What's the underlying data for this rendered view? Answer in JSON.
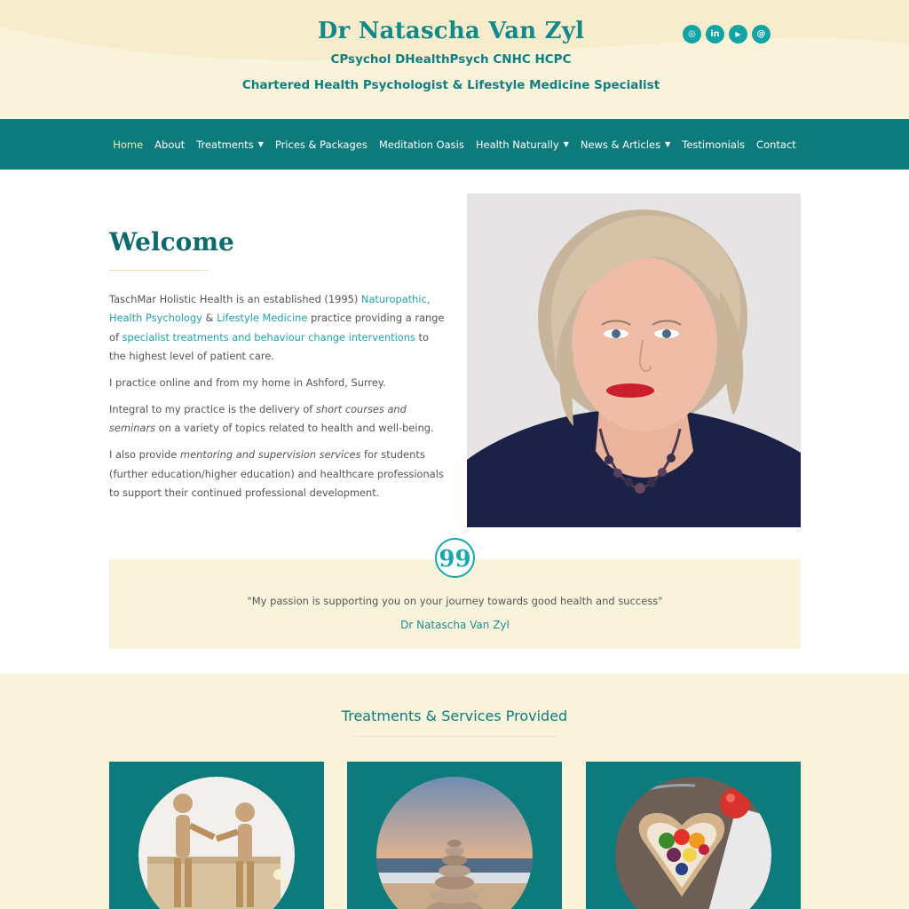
{
  "header": {
    "title": "Dr Natascha Van Zyl",
    "credentials": "CPsychol DHealthPsych CNHC HCPC",
    "tagline": "Chartered Health Psychologist & Lifestyle Medicine Specialist",
    "social": [
      {
        "icon": "instagram-icon",
        "glyph": "◎"
      },
      {
        "icon": "linkedin-icon",
        "glyph": "in"
      },
      {
        "icon": "youtube-icon",
        "glyph": "▶"
      },
      {
        "icon": "email-icon",
        "glyph": "@"
      }
    ]
  },
  "nav": {
    "items": [
      {
        "label": "Home",
        "active": true
      },
      {
        "label": "About"
      },
      {
        "label": "Treatments",
        "dropdown": true
      },
      {
        "label": "Prices & Packages"
      },
      {
        "label": "Meditation Oasis"
      },
      {
        "label": "Health Naturally",
        "dropdown": true
      },
      {
        "label": "News & Articles",
        "dropdown": true
      },
      {
        "label": "Testimonials"
      },
      {
        "label": "Contact"
      }
    ]
  },
  "welcome": {
    "title": "Welcome",
    "p1_a": "TaschMar Holistic Health is an established (1995) ",
    "p1_link1": "Naturopathic, Health Psychology",
    "p1_b": " & ",
    "p1_link2": "Lifestyle Medicine",
    "p1_c": " practice providing a range of ",
    "p1_link3": "specialist treatments and behaviour change interventions",
    "p1_d": " to the highest level of patient care.",
    "p2": "I practice online and from my home in Ashford, Surrey.",
    "p3_a": "Integral to my practice is the delivery of ",
    "p3_em": "short courses and seminars",
    "p3_b": " on a variety of topics related to health and well-being.",
    "p4_a": "I also provide ",
    "p4_em": "mentoring and supervision services",
    "p4_b": " for students (further education/higher education) and healthcare professionals to support their continued professional development."
  },
  "quote": {
    "icon_glyph": "99",
    "text": "\"My passion is supporting you on your journey towards good health and success\"",
    "author": "Dr Natascha Van Zyl"
  },
  "services": {
    "title": "Treatments & Services Provided"
  },
  "colors": {
    "teal": "#0d7b7c",
    "cream": "#faf3dc",
    "link": "#21a3a8"
  }
}
